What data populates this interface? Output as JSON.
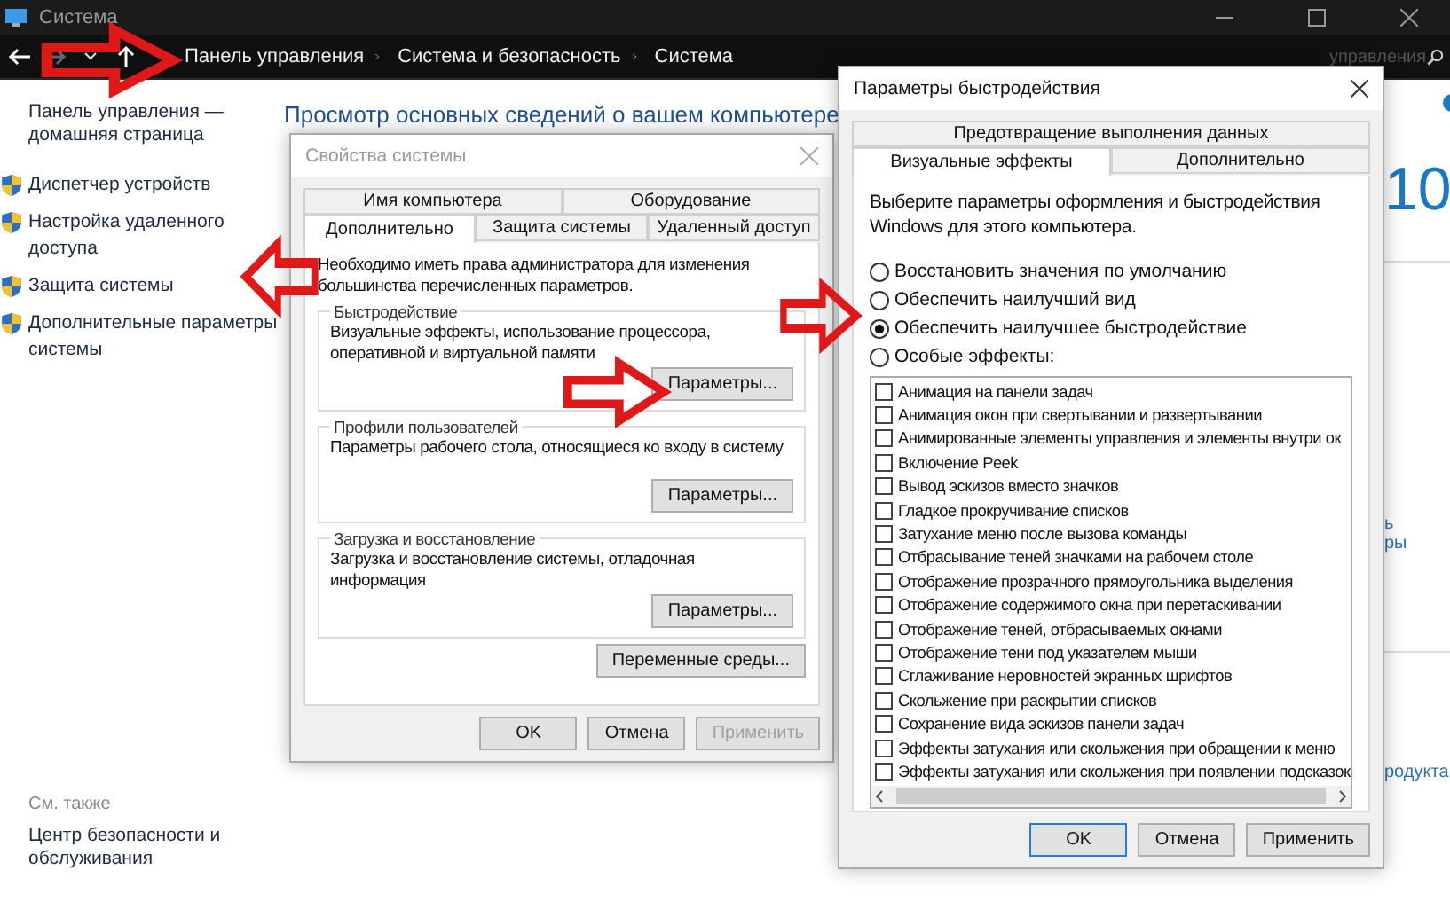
{
  "window": {
    "title": "Система",
    "breadcrumb": [
      "Панель управления",
      "Система и безопасность",
      "Система"
    ],
    "search_placeholder": "управления"
  },
  "sidebar": {
    "home_link": "Панель управления — домашняя страница",
    "items": [
      "Диспетчер устройств",
      "Настройка удаленного доступа",
      "Защита системы",
      "Дополнительные параметры системы"
    ],
    "see_also_title": "См. также",
    "see_also_links": [
      "Центр безопасности и обслуживания"
    ]
  },
  "main": {
    "heading": "Просмотр основных сведений о вашем компьютере",
    "edition_fragment": "10",
    "link_fragments": [
      "ь",
      "ры"
    ],
    "product_fragment": "родукта"
  },
  "system_properties": {
    "title": "Свойства системы",
    "tab_rows": [
      [
        {
          "label": "Имя компьютера",
          "selected": false
        },
        {
          "label": "Оборудование",
          "selected": false
        }
      ],
      [
        {
          "label": "Дополнительно",
          "selected": true
        },
        {
          "label": "Защита системы",
          "selected": false
        },
        {
          "label": "Удаленный доступ",
          "selected": false
        }
      ]
    ],
    "note": "Необходимо иметь права администратора для изменения большинства перечисленных параметров.",
    "groups": [
      {
        "title": "Быстродействие",
        "description": "Визуальные эффекты, использование процессора, оперативной и виртуальной памяти",
        "button": "Параметры..."
      },
      {
        "title": "Профили пользователей",
        "description": "Параметры рабочего стола, относящиеся ко входу в систему",
        "button": "Параметры..."
      },
      {
        "title": "Загрузка и восстановление",
        "description": "Загрузка и восстановление системы, отладочная информация",
        "button": "Параметры..."
      }
    ],
    "env_button": "Переменные среды...",
    "buttons": [
      {
        "label": "OK",
        "disabled": false
      },
      {
        "label": "Отмена",
        "disabled": false
      },
      {
        "label": "Применить",
        "disabled": true
      }
    ]
  },
  "performance_options": {
    "title": "Параметры быстродействия",
    "tab_rows": [
      [
        {
          "label": "Предотвращение выполнения данных",
          "selected": false
        }
      ],
      [
        {
          "label": "Визуальные эффекты",
          "selected": true
        },
        {
          "label": "Дополнительно",
          "selected": false
        }
      ]
    ],
    "intro": "Выберите параметры оформления и быстродействия Windows для этого компьютера.",
    "options": [
      {
        "label": "Восстановить значения по умолчанию",
        "selected": false
      },
      {
        "label": "Обеспечить наилучший вид",
        "selected": false
      },
      {
        "label": "Обеспечить наилучшее быстродействие",
        "selected": true
      },
      {
        "label": "Особые эффекты:",
        "selected": false
      }
    ],
    "effects": [
      {
        "label": "Анимация на панели задач",
        "checked": false
      },
      {
        "label": "Анимация окон при свертывании и развертывании",
        "checked": false
      },
      {
        "label": "Анимированные элементы управления и элементы внутри ок",
        "checked": false
      },
      {
        "label": "Включение Peek",
        "checked": false
      },
      {
        "label": "Вывод эскизов вместо значков",
        "checked": false
      },
      {
        "label": "Гладкое прокручивание списков",
        "checked": false
      },
      {
        "label": "Затухание меню после вызова команды",
        "checked": false
      },
      {
        "label": "Отбрасывание теней значками на рабочем столе",
        "checked": false
      },
      {
        "label": "Отображение прозрачного прямоугольника выделения",
        "checked": false
      },
      {
        "label": "Отображение содержимого окна при перетаскивании",
        "checked": false
      },
      {
        "label": "Отображение теней, отбрасываемых окнами",
        "checked": false
      },
      {
        "label": "Отображение тени под указателем мыши",
        "checked": false
      },
      {
        "label": "Сглаживание неровностей экранных шрифтов",
        "checked": false
      },
      {
        "label": "Скольжение при раскрытии списков",
        "checked": false
      },
      {
        "label": "Сохранение вида эскизов панели задач",
        "checked": false
      },
      {
        "label": "Эффекты затухания или скольжения при обращении к меню",
        "checked": false
      },
      {
        "label": "Эффекты затухания или скольжения при появлении подсказок",
        "checked": false
      }
    ],
    "buttons": [
      {
        "label": "OK",
        "default": true
      },
      {
        "label": "Отмена",
        "default": false
      },
      {
        "label": "Применить",
        "default": false
      }
    ]
  }
}
